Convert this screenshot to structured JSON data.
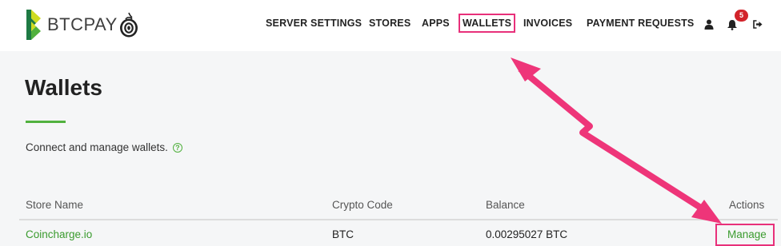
{
  "brand": {
    "name": "BTCPAY"
  },
  "nav": {
    "items": [
      {
        "label": "SERVER SETTINGS"
      },
      {
        "label": "STORES"
      },
      {
        "label": "APPS"
      },
      {
        "label": "WALLETS"
      },
      {
        "label": "INVOICES"
      },
      {
        "label": "PAYMENT REQUESTS"
      }
    ],
    "notification_count": "5"
  },
  "page": {
    "title": "Wallets",
    "description": "Connect and manage wallets."
  },
  "table": {
    "headers": [
      "Store Name",
      "Crypto Code",
      "Balance",
      "Actions"
    ],
    "rows": [
      {
        "store": "Coincharge.io",
        "code": "BTC",
        "balance": "0.00295027 BTC",
        "action": "Manage"
      }
    ]
  },
  "colors": {
    "accent": "#51b13e",
    "link": "#3a9b2e",
    "annotation": "#e8307a",
    "badge": "#d2232a"
  },
  "icons": [
    "btcpay-logo-icon",
    "tor-onion-icon",
    "user-icon",
    "bell-icon",
    "logout-icon",
    "help-circle-icon"
  ]
}
